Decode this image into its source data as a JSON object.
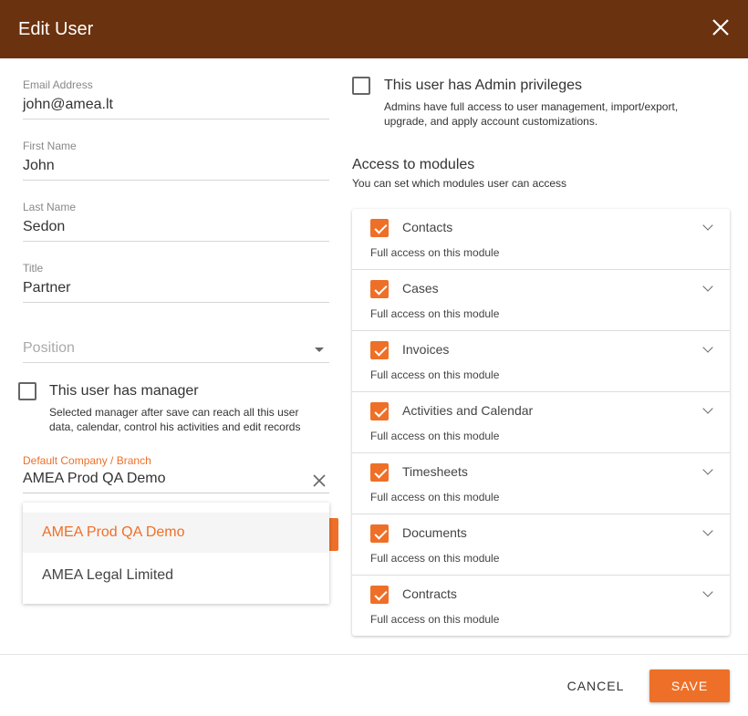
{
  "dialog": {
    "title": "Edit User",
    "close_icon": "close-icon"
  },
  "form": {
    "email": {
      "label": "Email Address",
      "value": "john@amea.lt"
    },
    "first_name": {
      "label": "First Name",
      "value": "John"
    },
    "last_name": {
      "label": "Last Name",
      "value": "Sedon"
    },
    "title": {
      "label": "Title",
      "value": "Partner"
    },
    "position": {
      "placeholder": "Position"
    },
    "manager": {
      "label": "This user has manager",
      "checked": false,
      "help": "Selected manager after save can reach all this user data, calendar, control his activities and edit records"
    },
    "company": {
      "label": "Default Company / Branch",
      "value": "AMEA Prod QA Demo",
      "options": [
        "AMEA Prod QA Demo",
        "AMEA Legal Limited"
      ],
      "highlighted": "AMEA Prod QA Demo"
    }
  },
  "admin": {
    "label": "This user has Admin privileges",
    "checked": false,
    "help": "Admins have full access to user management, import/export, upgrade, and apply account customizations."
  },
  "modules": {
    "title": "Access to modules",
    "subtitle": "You can set which modules user can access",
    "items": [
      {
        "name": "Contacts",
        "desc": "Full access on this module",
        "checked": true
      },
      {
        "name": "Cases",
        "desc": "Full access on this module",
        "checked": true
      },
      {
        "name": "Invoices",
        "desc": "Full access on this module",
        "checked": true
      },
      {
        "name": "Activities and Calendar",
        "desc": "Full access on this module",
        "checked": true
      },
      {
        "name": "Timesheets",
        "desc": "Full access on this module",
        "checked": true
      },
      {
        "name": "Documents",
        "desc": "Full access on this module",
        "checked": true
      },
      {
        "name": "Contracts",
        "desc": "Full access on this module",
        "checked": true
      }
    ]
  },
  "footer": {
    "cancel": "CANCEL",
    "save": "SAVE"
  },
  "colors": {
    "header": "#6b320f",
    "accent": "#ee7028"
  }
}
